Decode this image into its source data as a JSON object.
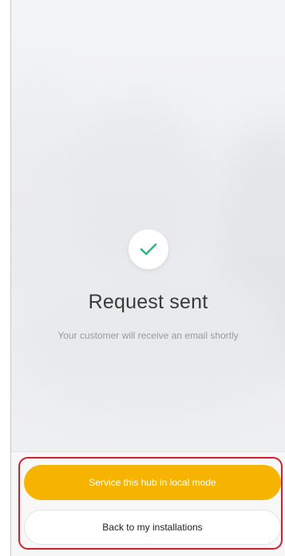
{
  "status": {
    "icon": "checkmark-icon",
    "accent_color": "#2db87a",
    "title": "Request sent",
    "message": "Your customer will receive an email shortly"
  },
  "actions": {
    "primary_label": "Service this hub in local mode",
    "primary_color": "#f6b400",
    "secondary_label": "Back to my installations"
  }
}
